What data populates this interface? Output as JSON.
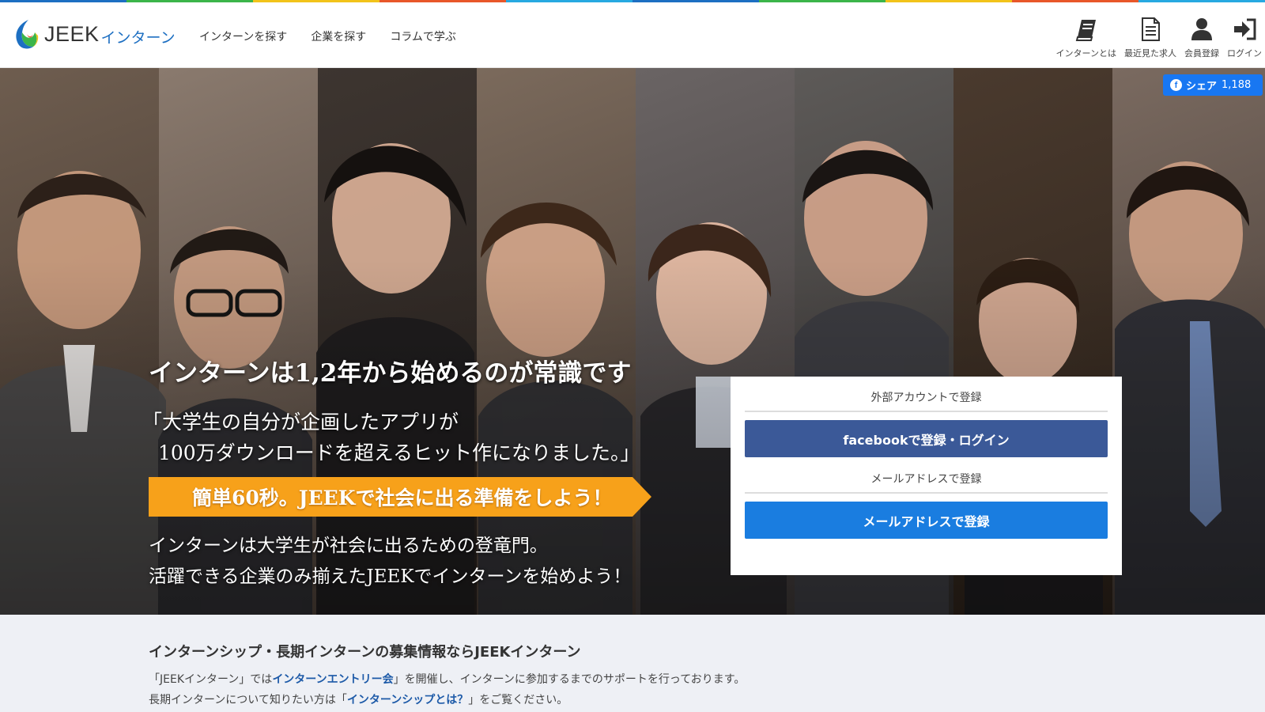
{
  "colors": {
    "strip": [
      "#1d6fc2",
      "#3bb54a",
      "#f2c31a",
      "#e8572a",
      "#27a9e1",
      "#1d6fc2",
      "#3bb54a",
      "#f2c31a",
      "#e8572a",
      "#27a9e1"
    ],
    "facebook": "#3b5998",
    "mail": "#1a7de0",
    "cta": "#f7a11a",
    "link": "#1d5aa8"
  },
  "header": {
    "logo_main": "JEEK",
    "logo_sub": "インターン",
    "nav": [
      {
        "label": "インターンを探す"
      },
      {
        "label": "企業を探す"
      },
      {
        "label": "コラムで学ぶ"
      }
    ],
    "icons": [
      {
        "icon": "book-icon",
        "label": "インターンとは"
      },
      {
        "icon": "document-icon",
        "label": "最近見た求人"
      },
      {
        "icon": "user-icon",
        "label": "会員登録"
      },
      {
        "icon": "login-icon",
        "label": "ログイン"
      }
    ]
  },
  "hero": {
    "share": {
      "label": "シェア",
      "count": "1,188"
    },
    "headline": "インターンは1,2年から始めるのが常識です",
    "quote_line1": "「大学生の自分が企画したアプリが",
    "quote_line2": "100万ダウンロードを超えるヒット作になりました。」",
    "cta": "簡単60秒。JEEKで社会に出る準備をしよう！",
    "sub_line1": "インターンは大学生が社会に出るための登竜門。",
    "sub_line2": "活躍できる企業のみ揃えたJEEKでインターンを始めよう！"
  },
  "register": {
    "external_heading": "外部アカウントで登録",
    "facebook_button": "facebookで登録・ログイン",
    "mail_heading": "メールアドレスで登録",
    "mail_button": "メールアドレスで登録"
  },
  "info": {
    "title": "インターンシップ・長期インターンの募集情報ならJEEKインターン",
    "line1_pre": "「JEEKインターン」では",
    "line1_link": "インターンエントリー会",
    "line1_post": "」を開催し、インターンに参加するまでのサポートを行っております。",
    "line2_pre": "長期インターンについて知りたい方は「",
    "line2_link": "インターンシップとは？",
    "line2_post": "」をご覧ください。"
  }
}
